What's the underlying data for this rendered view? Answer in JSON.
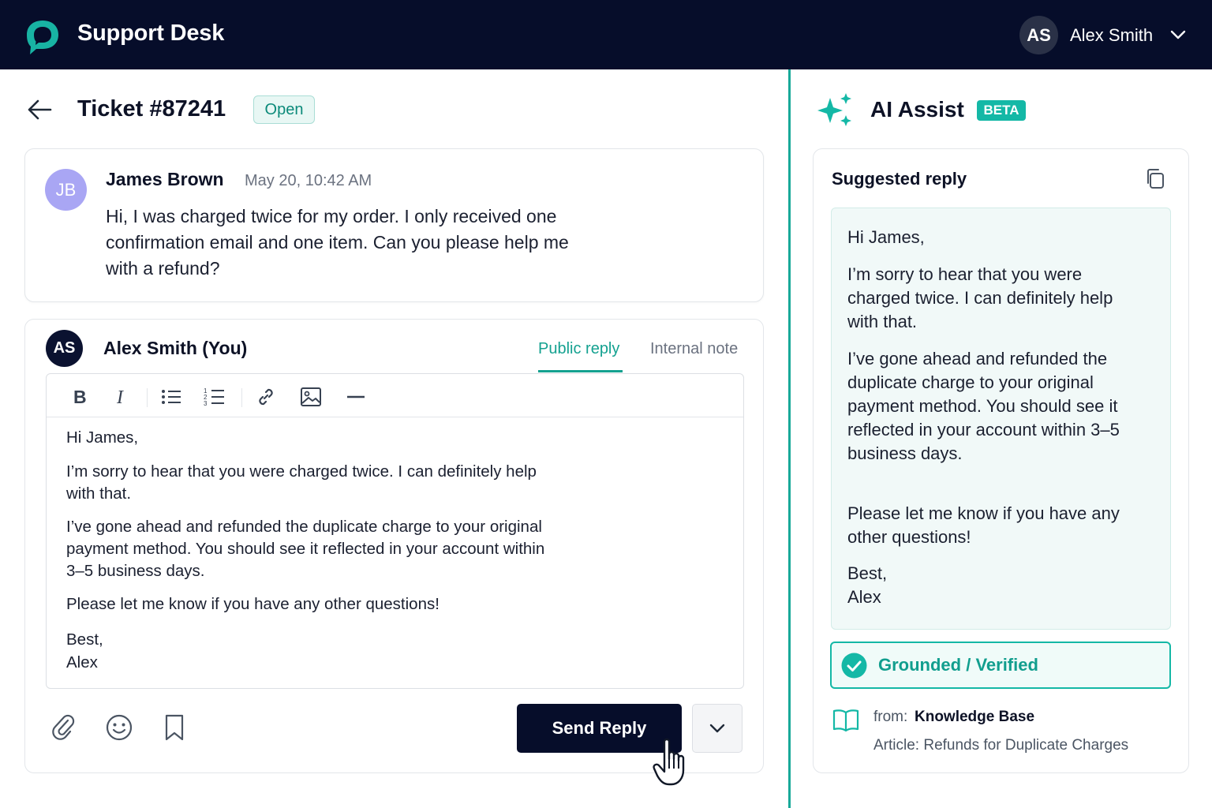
{
  "app": {
    "title": "Support Desk",
    "brand_color": "#14b8a6",
    "header_bg": "#060d2a"
  },
  "user": {
    "initials": "AS",
    "name": "Alex Smith"
  },
  "ticket": {
    "title": "Ticket #87241",
    "status": "Open"
  },
  "message": {
    "initials": "JB",
    "author": "James Brown",
    "time": "May 20, 10:42 AM",
    "body": "Hi, I was charged twice for my order. I only received one confirmation email and one item. Can you please help me with a refund?"
  },
  "reply": {
    "initials": "AS",
    "author": "Alex Smith (You)",
    "tabs": {
      "public": "Public reply",
      "internal": "Internal note"
    },
    "toolbar": [
      "bold",
      "italic",
      "bullet-list",
      "numbered-list",
      "link",
      "image",
      "horizontal-rule"
    ],
    "editor": {
      "p1": "Hi James,",
      "p2": "I’m sorry to hear that you were charged twice. I can definitely help with that.",
      "p3": "I’ve gone ahead and refunded the duplicate charge to your original payment method. You should see it reflected in your account within 3–5 business days.",
      "p4": "Please let me know if you have any other questions!",
      "p5a": "Best,",
      "p5b": "Alex"
    },
    "send_label": "Send Reply"
  },
  "ai": {
    "title": "AI Assist",
    "badge": "BETA",
    "suggest_title": "Suggested reply",
    "suggestion": {
      "p1": "Hi James,",
      "p2": "I’m sorry to hear that you were charged twice. I can definitely help with that.",
      "p3": "I’ve gone ahead and refunded the duplicate charge to your original payment method. You should see it reflected in your account within 3–5 business days.",
      "p4": "Please let me know if you have any other questions!",
      "p5a": "Best,",
      "p5b": "Alex"
    },
    "verified_label": "Grounded / Verified",
    "source_from": "from:",
    "source_name": "Knowledge Base",
    "source_article": "Article: Refunds for Duplicate Charges"
  }
}
